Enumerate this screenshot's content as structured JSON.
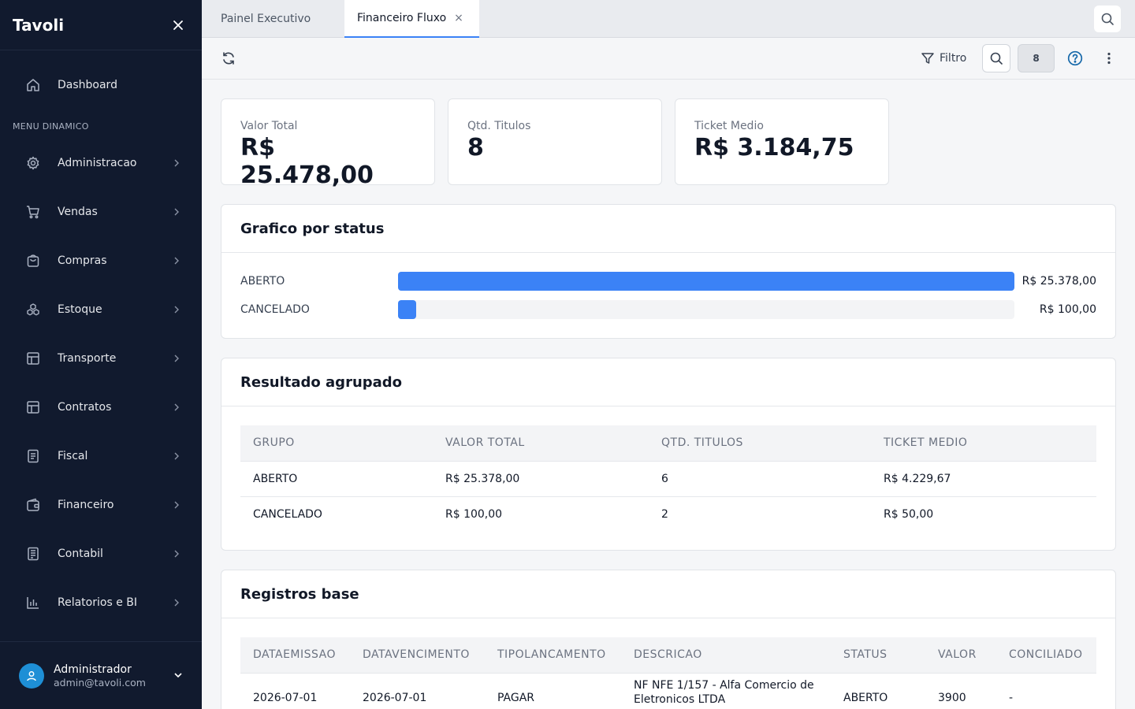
{
  "app": {
    "brand": "Tavoli"
  },
  "sidebar": {
    "dashboard_label": "Dashboard",
    "section_label": "MENU DINAMICO",
    "items": [
      {
        "label": "Administracao",
        "icon": "gear-icon"
      },
      {
        "label": "Vendas",
        "icon": "cart-icon"
      },
      {
        "label": "Compras",
        "icon": "bag-icon"
      },
      {
        "label": "Estoque",
        "icon": "boxes-icon"
      },
      {
        "label": "Transporte",
        "icon": "layout-icon"
      },
      {
        "label": "Contratos",
        "icon": "layout-icon"
      },
      {
        "label": "Fiscal",
        "icon": "document-icon"
      },
      {
        "label": "Financeiro",
        "icon": "wallet-icon"
      },
      {
        "label": "Contabil",
        "icon": "ledger-icon"
      },
      {
        "label": "Relatorios e BI",
        "icon": "bar-chart-icon"
      }
    ],
    "user": {
      "name": "Administrador",
      "email": "admin@tavoli.com"
    }
  },
  "tabs": [
    {
      "label": "Painel Executivo",
      "active": false
    },
    {
      "label": "Financeiro Fluxo",
      "active": true,
      "close": "×"
    }
  ],
  "toolbar": {
    "filter_label": "Filtro",
    "count": "8"
  },
  "kpis": [
    {
      "label": "Valor Total",
      "value": "R$ 25.478,00"
    },
    {
      "label": "Qtd. Titulos",
      "value": "8"
    },
    {
      "label": "Ticket Medio",
      "value": "R$ 3.184,75"
    }
  ],
  "status_chart": {
    "title": "Grafico por status",
    "bars": [
      {
        "label": "ABERTO",
        "value_text": "R$ 25.378,00",
        "fraction": 1.0
      },
      {
        "label": "CANCELADO",
        "value_text": "R$ 100,00",
        "fraction": 0.0039
      }
    ]
  },
  "grouped": {
    "title": "Resultado agrupado",
    "headers": [
      "GRUPO",
      "VALOR TOTAL",
      "QTD. TITULOS",
      "TICKET MEDIO"
    ],
    "rows": [
      [
        "ABERTO",
        "R$ 25.378,00",
        "6",
        "R$ 4.229,67"
      ],
      [
        "CANCELADO",
        "R$ 100,00",
        "2",
        "R$ 50,00"
      ]
    ]
  },
  "records": {
    "title": "Registros base",
    "headers": [
      "DATAEMISSAO",
      "DATAVENCIMENTO",
      "TIPOLANCAMENTO",
      "DESCRICAO",
      "STATUS",
      "VALOR",
      "CONCILIADO"
    ],
    "rows": [
      [
        "2026-07-01",
        "2026-07-01",
        "PAGAR",
        "NF NFE 1/157 - Alfa Comercio de Eletronicos LTDA",
        "ABERTO",
        "3900",
        "-"
      ]
    ]
  },
  "colors": {
    "sidebar_bg": "#111a2e",
    "accent": "#3b82f6",
    "avatar": "#1e8fd6"
  }
}
